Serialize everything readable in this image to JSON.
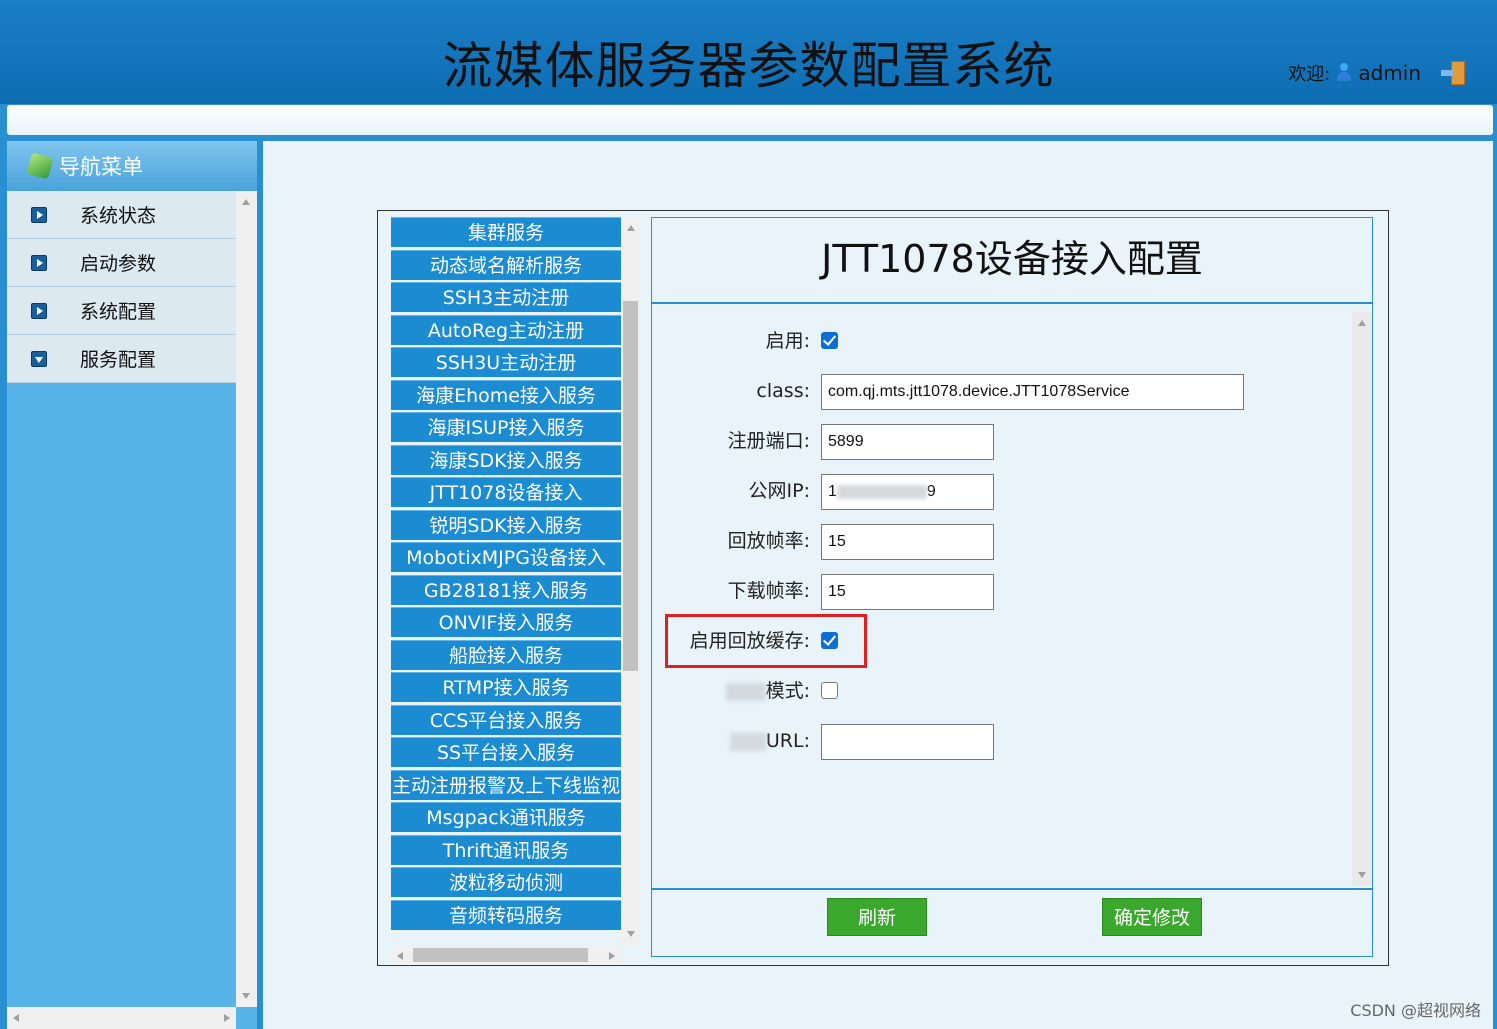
{
  "header": {
    "title": "流媒体服务器参数配置系统",
    "welcome_label": "欢迎:",
    "username": "admin"
  },
  "sidebar": {
    "title": "导航菜单",
    "items": [
      {
        "label": "系统状态"
      },
      {
        "label": "启动参数"
      },
      {
        "label": "系统配置"
      },
      {
        "label": "服务配置"
      }
    ]
  },
  "services": [
    "集群服务",
    "动态域名解析服务",
    "SSH3主动注册",
    "AutoReg主动注册",
    "SSH3U主动注册",
    "海康Ehome接入服务",
    "海康ISUP接入服务",
    "海康SDK接入服务",
    "JTT1078设备接入",
    "锐明SDK接入服务",
    "MobotixMJPG设备接入",
    "GB28181接入服务",
    "ONVIF接入服务",
    "船脸接入服务",
    "RTMP接入服务",
    "CCS平台接入服务",
    "SS平台接入服务",
    "主动注册报警及上下线监视",
    "Msgpack通讯服务",
    "Thrift通讯服务",
    "波粒移动侦测",
    "音频转码服务"
  ],
  "config": {
    "title": "JTT1078设备接入配置",
    "enabled_label": "启用:",
    "enabled": true,
    "class_label": "class:",
    "class_value": "com.qj.mts.jtt1078.device.JTT1078Service",
    "port_label": "注册端口:",
    "port_value": "5899",
    "ip_label": "公网IP:",
    "ip_prefix": "1",
    "ip_suffix": "9",
    "playback_fps_label": "回放帧率:",
    "playback_fps_value": "15",
    "download_fps_label": "下载帧率:",
    "download_fps_value": "15",
    "playback_cache_label": "启用回放缓存:",
    "playback_cache": true,
    "mode_label": "模式:",
    "mode_enabled": false,
    "url_label": "URL:",
    "url_value": ""
  },
  "buttons": {
    "refresh": "刷新",
    "confirm": "确定修改"
  },
  "watermark": "CSDN @超视网络"
}
